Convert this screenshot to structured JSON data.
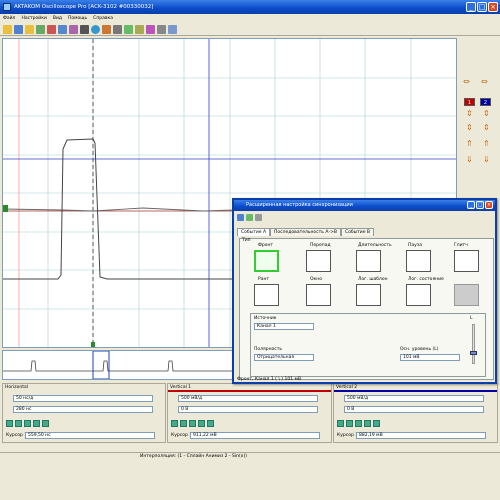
{
  "window": {
    "title": "AKTAKOM Oscilloscope Pro [ACK-3102 #00330032]"
  },
  "menu": [
    "Файл",
    "Настройки",
    "Вид",
    "Помощь",
    "Справка"
  ],
  "plot": {
    "ch_marker": "1"
  },
  "right_panel": {
    "ch1_label": "1",
    "ch2_label": "2",
    "ch1_color": "#c00000",
    "ch2_color": "#0000a0"
  },
  "bottom": {
    "horizontal": {
      "title": "Horizontal",
      "field1": "50 нс/д",
      "field2": "280 нс",
      "cursor_label": "Курсор 1",
      "cursor_value": "559,50 нс"
    },
    "vertical1": {
      "title": "Vertical 1",
      "field1": "500 мВ/д",
      "field2": "0 В",
      "cursor_label": "Курсор 1",
      "cursor_value": "911,22 мВ"
    },
    "vertical2": {
      "title": "Vertical 2",
      "field1": "500 мВ/д",
      "field2": "0 В",
      "cursor_label": "Курсор 1",
      "cursor_value": "882,19 мВ"
    }
  },
  "status": {
    "text": "Интерполяция: (1 - Сплайн Анимиз 2 - Sin(х))"
  },
  "dialog": {
    "title": "Расширенная настройка синхронизации",
    "tabs": [
      "Событие А",
      "Последовательность А->B",
      "Событие B"
    ],
    "group_title": "Тип",
    "events": [
      "Фронт",
      "Перепад",
      "Длительность",
      "Пауза",
      "Глитч",
      "Рант",
      "Окно",
      "Лог. шаблон",
      "Лог. состояние"
    ],
    "source_label": "Источник",
    "source_value": "Канал 1",
    "polarity_label": "Полярность",
    "polarity_value": "Отрицательная",
    "level_label": "Осн. уровень (L)",
    "level_value": "101 мВ",
    "slider_label": "L",
    "status": "Фронт, Канал 1 ( \\ ) 101 мВ"
  }
}
